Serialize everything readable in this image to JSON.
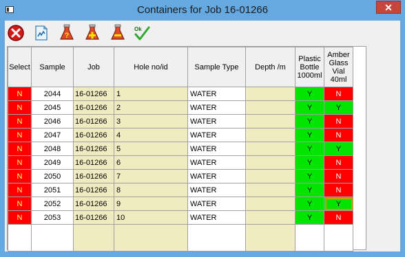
{
  "window": {
    "title": "Containers for Job 16-01266",
    "close_label": "✕"
  },
  "toolbar": {
    "buttons": [
      "close-red-icon",
      "edit-doc-icon",
      "help-flask-icon",
      "add-flask-icon",
      "remove-flask-icon",
      "ok-check-icon"
    ],
    "ok_text": "Ok"
  },
  "columns": [
    "Select",
    "Sample",
    "Job",
    "Hole no/id",
    "Sample Type",
    "Depth /m",
    "Plastic Bottle 1000ml",
    "Amber Glass Vial 40ml"
  ],
  "rows": [
    {
      "select": "N",
      "sample": "2044",
      "job": "16-01266",
      "hole": "1",
      "type": "WATER",
      "depth": "",
      "plastic": "Y",
      "amber": "N"
    },
    {
      "select": "N",
      "sample": "2045",
      "job": "16-01266",
      "hole": "2",
      "type": "WATER",
      "depth": "",
      "plastic": "Y",
      "amber": "Y"
    },
    {
      "select": "N",
      "sample": "2046",
      "job": "16-01266",
      "hole": "3",
      "type": "WATER",
      "depth": "",
      "plastic": "Y",
      "amber": "N"
    },
    {
      "select": "N",
      "sample": "2047",
      "job": "16-01266",
      "hole": "4",
      "type": "WATER",
      "depth": "",
      "plastic": "Y",
      "amber": "N"
    },
    {
      "select": "N",
      "sample": "2048",
      "job": "16-01266",
      "hole": "5",
      "type": "WATER",
      "depth": "",
      "plastic": "Y",
      "amber": "Y"
    },
    {
      "select": "N",
      "sample": "2049",
      "job": "16-01266",
      "hole": "6",
      "type": "WATER",
      "depth": "",
      "plastic": "Y",
      "amber": "N"
    },
    {
      "select": "N",
      "sample": "2050",
      "job": "16-01266",
      "hole": "7",
      "type": "WATER",
      "depth": "",
      "plastic": "Y",
      "amber": "N"
    },
    {
      "select": "N",
      "sample": "2051",
      "job": "16-01266",
      "hole": "8",
      "type": "WATER",
      "depth": "",
      "plastic": "Y",
      "amber": "N"
    },
    {
      "select": "N",
      "sample": "2052",
      "job": "16-01266",
      "hole": "9",
      "type": "WATER",
      "depth": "",
      "plastic": "Y",
      "amber": "Y"
    },
    {
      "select": "N",
      "sample": "2053",
      "job": "16-01266",
      "hole": "10",
      "type": "WATER",
      "depth": "",
      "plastic": "Y",
      "amber": "N"
    }
  ],
  "colors": {
    "yes": "#00e400",
    "no": "#ff0000",
    "readonly": "#f0ebc0",
    "titlebar": "#66a9e1"
  }
}
